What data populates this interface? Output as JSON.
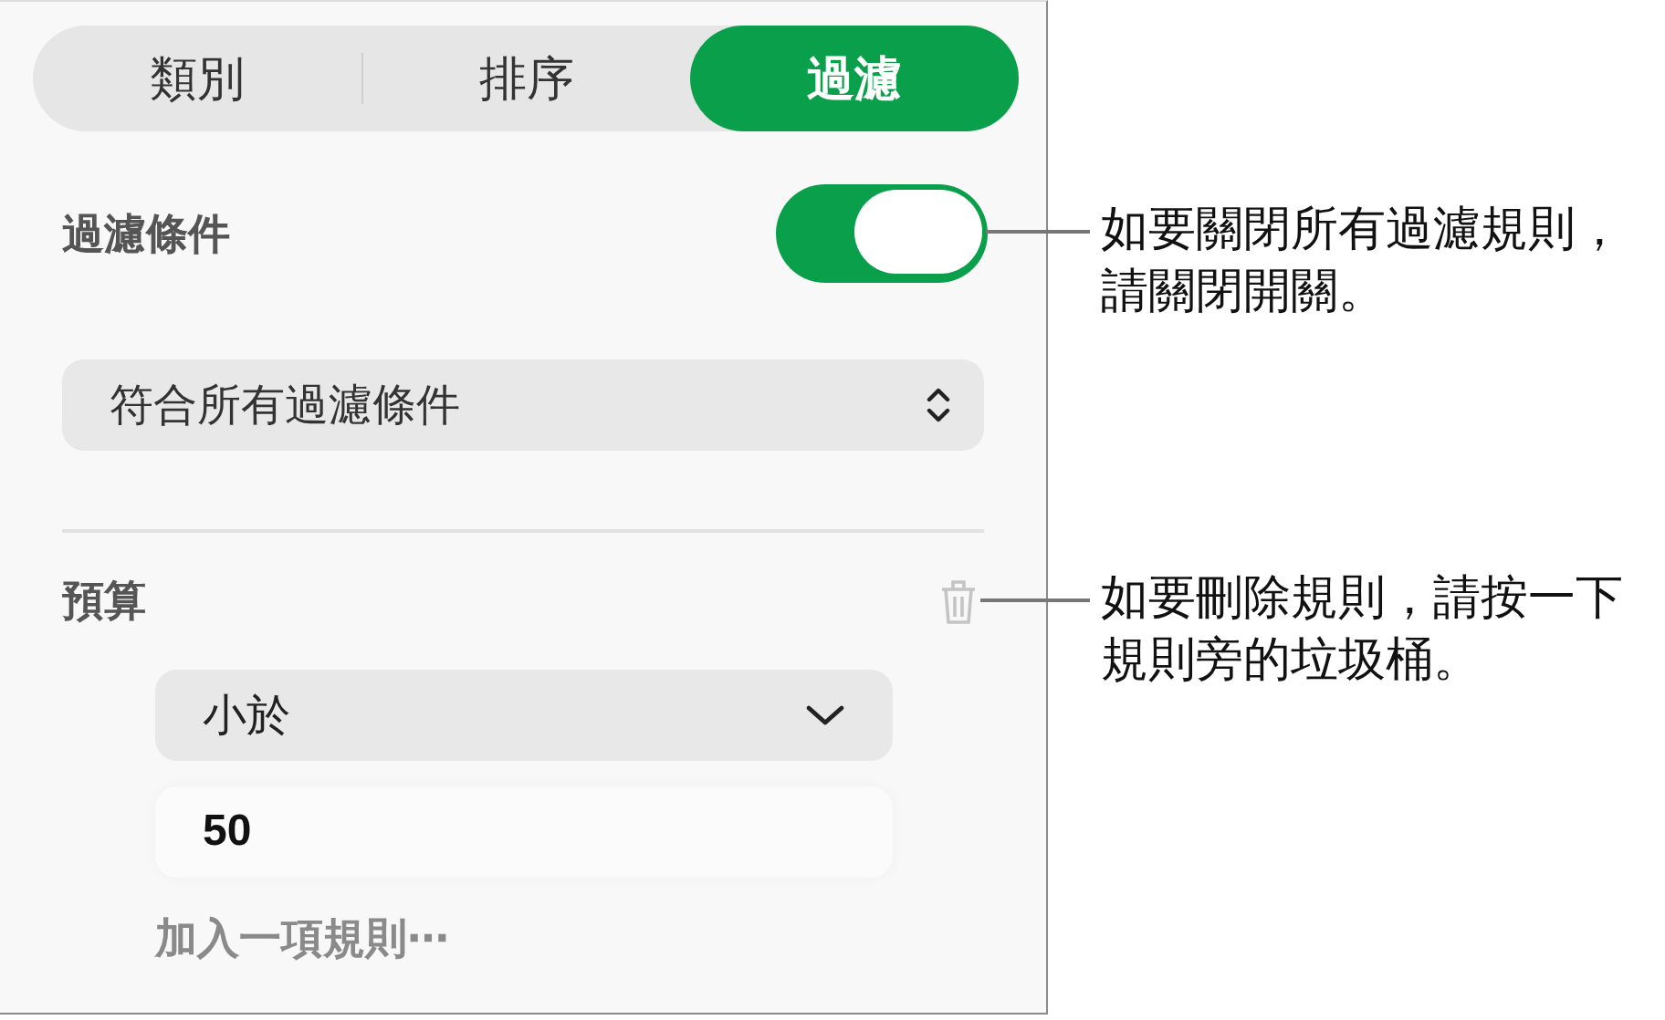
{
  "tabs": [
    {
      "label": "類別",
      "selected": false
    },
    {
      "label": "排序",
      "selected": false
    },
    {
      "label": "過濾",
      "selected": true
    }
  ],
  "filter_toggle": {
    "label": "過濾條件",
    "on": true
  },
  "match_popup": {
    "value": "符合所有過濾條件"
  },
  "rule": {
    "column": "預算",
    "operator": "小於",
    "value": "50"
  },
  "add_rule": "加入一項規則⋯",
  "callouts": [
    {
      "kind": "toggle",
      "lines": [
        "如要關閉所有過濾規則，",
        "請關閉開關。"
      ]
    },
    {
      "kind": "trash",
      "lines": [
        "如要刪除規則，請按一下",
        "規則旁的垃圾桶。"
      ]
    }
  ]
}
